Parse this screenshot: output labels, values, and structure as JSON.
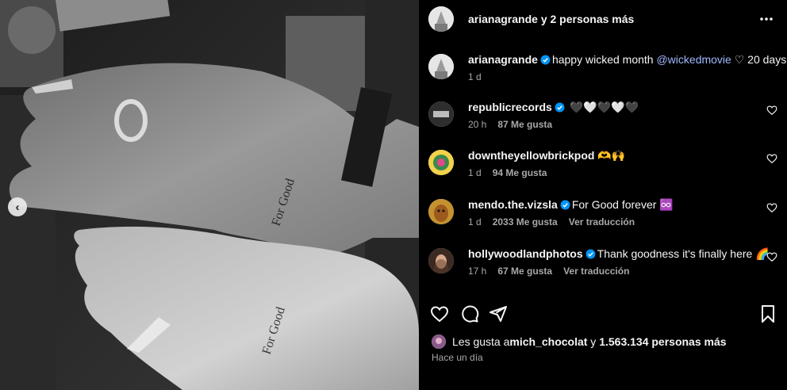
{
  "header": {
    "author_line": "arianagrande y 2 personas más"
  },
  "caption": {
    "username": "arianagrande",
    "text_before": "happy wicked month ",
    "mention": "@wickedmovie",
    "text_after": " ♡ 20 days",
    "time": "1 d"
  },
  "comments": [
    {
      "username": "republicrecords",
      "verified": true,
      "text": " 🖤🤍🖤🤍🖤",
      "time": "20 h",
      "likes": "87 Me gusta",
      "translate": ""
    },
    {
      "username": "downtheyellowbrickpod",
      "verified": false,
      "text": " 🫶🙌",
      "time": "1 d",
      "likes": "94 Me gusta",
      "translate": ""
    },
    {
      "username": "mendo.the.vizsla",
      "verified": true,
      "text": "For Good forever ♾️",
      "time": "1 d",
      "likes": "2033 Me gusta",
      "translate": "Ver traducción"
    },
    {
      "username": "hollywoodlandphotos",
      "verified": true,
      "text": "Thank goodness it's finally here 🌈",
      "time": "17 h",
      "likes": "67 Me gusta",
      "translate": "Ver traducción"
    }
  ],
  "likes": {
    "prefix": "Les gusta a ",
    "user": "mich_chocolat",
    "middle": " y ",
    "count": "1.563.134 personas más"
  },
  "timestamp": "Hace un día",
  "media": {
    "tattoo_text": "For Good",
    "nav_prev": "‹"
  },
  "icons": {
    "more": "more-options-icon",
    "like": "heart-icon",
    "comment": "comment-icon",
    "share": "share-icon",
    "save": "bookmark-icon",
    "verified": "verified-badge-icon"
  },
  "colors": {
    "background": "#000000",
    "text": "#f5f5f5",
    "secondary_text": "#a8a8a8",
    "mention": "#a0b9ff",
    "verified": "#0095f6"
  }
}
